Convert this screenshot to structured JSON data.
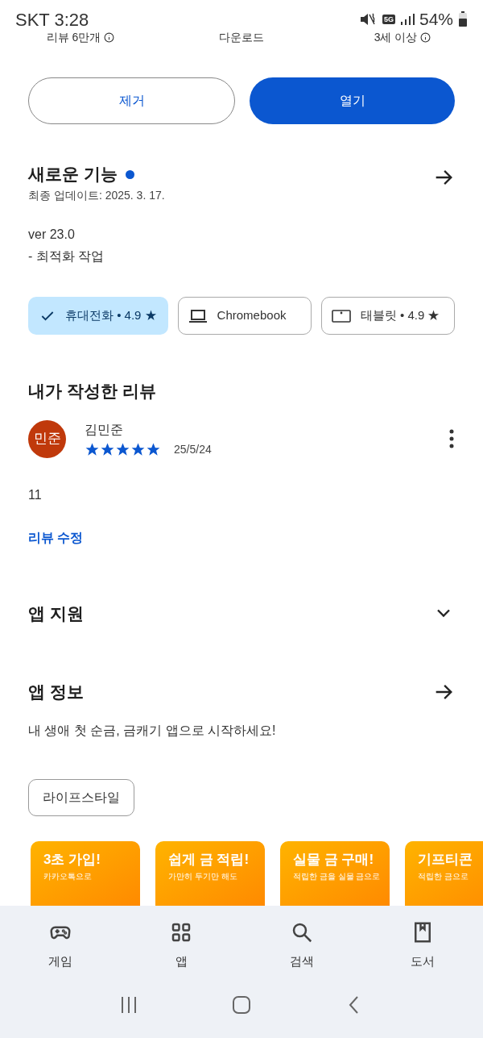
{
  "status_bar": {
    "carrier_time": "SKT 3:28",
    "network": "5G",
    "battery": "54%"
  },
  "stats": [
    {
      "label": "리뷰 6만개",
      "info": true
    },
    {
      "label": "다운로드",
      "info": false
    },
    {
      "label": "3세 이상",
      "info": true
    }
  ],
  "actions": [
    {
      "label": "제거",
      "kind": "outline"
    },
    {
      "label": "열기",
      "kind": "filled"
    }
  ],
  "whats_new": {
    "title": "새로운 기능",
    "updated": "최종 업데이트: 2025. 3. 17.",
    "version": "ver 23.0",
    "notes": "- 최적화 작업"
  },
  "devices": [
    {
      "kind": "phone",
      "label": "휴대전화 • 4.9 ★",
      "selected": true
    },
    {
      "kind": "laptop",
      "label": "Chromebook",
      "selected": false
    },
    {
      "kind": "tablet",
      "label": "태블릿 • 4.9 ★",
      "selected": false
    }
  ],
  "my_review": {
    "heading": "내가 작성한 리뷰",
    "avatar": "민준",
    "author": "김민준",
    "stars": 5,
    "date": "25/5/24",
    "body": "11",
    "edit_link": "리뷰 수정"
  },
  "app_support": {
    "title": "앱 지원",
    "expanded": false
  },
  "app_info": {
    "title": "앱 정보",
    "description": "내 생애 첫 순금, 금캐기 앱으로 시작하세요!",
    "category": "라이프스타일"
  },
  "screenshots": [
    {
      "headline": "3초 가입!",
      "caption": "카카오톡으로"
    },
    {
      "headline": "쉽게 금 적립!",
      "caption": "가만히 두기만 해도"
    },
    {
      "headline": "실물 금 구매!",
      "caption": "적립한 금을 실물 금으로"
    },
    {
      "headline": "기프티콘",
      "caption": "적립한 금으로"
    }
  ],
  "bottom_nav": [
    {
      "kind": "games",
      "label": "게임",
      "selected": false
    },
    {
      "kind": "apps",
      "label": "앱",
      "selected": false
    },
    {
      "kind": "search",
      "label": "검색",
      "selected": false
    },
    {
      "kind": "books",
      "label": "도서",
      "selected": false
    }
  ]
}
